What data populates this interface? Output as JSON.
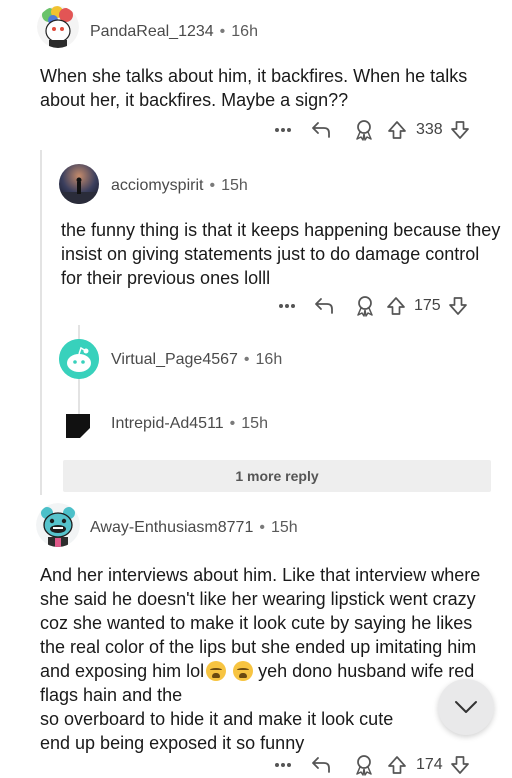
{
  "comments": [
    {
      "username": "PandaReal_1234",
      "time": "16h",
      "text": "When she talks about him, it backfires. When he talks about her, it backfires. Maybe a sign??",
      "votes": "338"
    },
    {
      "username": "acciomyspirit",
      "time": "15h",
      "text": "the funny thing is that it keeps happening because they insist on giving statements just to do damage control for their previous ones lolll",
      "votes": "175"
    },
    {
      "username": "Virtual_Page4567",
      "time": "16h"
    },
    {
      "username": "Intrepid-Ad4511",
      "time": "15h"
    },
    {
      "username": "Away-Enthusiasm8771",
      "time": "15h",
      "text_a": "And her interviews about him. Like that interview where she said he doesn't like her wearing lipstick went crazy coz she wanted to make it look cute by saying he likes the real color of the lips but she ended up imitating him and exposing him lol",
      "text_b": " yeh dono husband wife red flags hain and the",
      "text_c": " so overboard to hide it and make it look cute",
      "text_d": " end up being exposed it so funny",
      "votes": "174"
    }
  ],
  "more_replies": "1 more reply",
  "separator": "•",
  "icons": {
    "more": "more-options-icon",
    "reply": "reply-icon",
    "award": "award-icon",
    "upvote": "upvote-icon",
    "downvote": "downvote-icon",
    "scroll": "chevron-down-icon"
  }
}
